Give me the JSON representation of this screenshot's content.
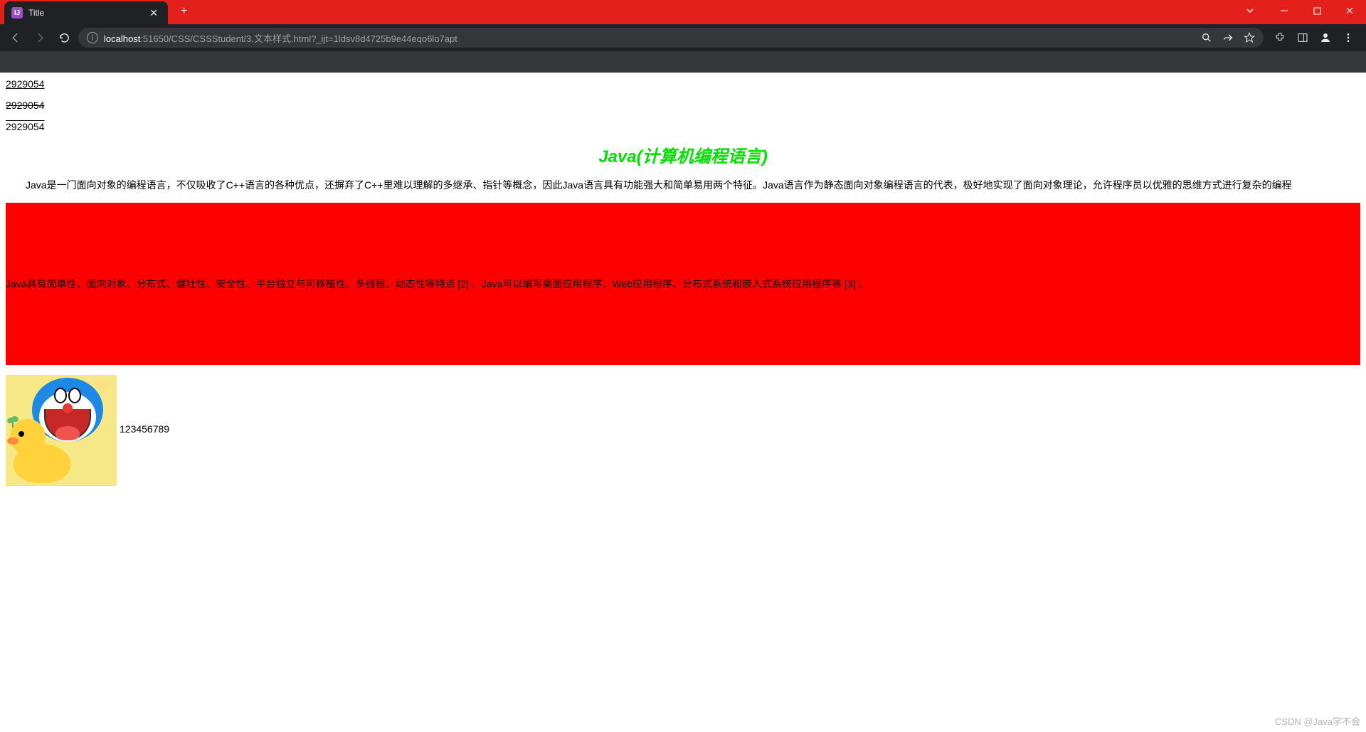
{
  "browser": {
    "tab_title": "Title",
    "url_host": "localhost",
    "url_rest": ":51650/CSS/CSSStudent/3.文本样式.html?_ijt=1ldsv8d4725b9e44eqo6lo7apt"
  },
  "texts": {
    "t1": "2929054",
    "t2": "2929054",
    "t3": "2929054"
  },
  "heading": "Java(计算机编程语言)",
  "para1": "Java是一门面向对象的编程语言，不仅吸收了C++语言的各种优点，还摒弃了C++里难以理解的多继承、指针等概念，因此Java语言具有功能强大和简单易用两个特征。Java语言作为静态面向对象编程语言的代表，极好地实现了面向对象理论，允许程序员以优雅的思维方式进行复杂的编程",
  "para2": "Java具有简单性、面向对象、分布式、健壮性、安全性、平台独立与可移植性、多线程、动态性等特点 [2] 。Java可以编写桌面应用程序、Web应用程序、分布式系统和嵌入式系统应用程序等 [3] 。",
  "img_label": "123456789",
  "watermark": "CSDN @Java学不会"
}
